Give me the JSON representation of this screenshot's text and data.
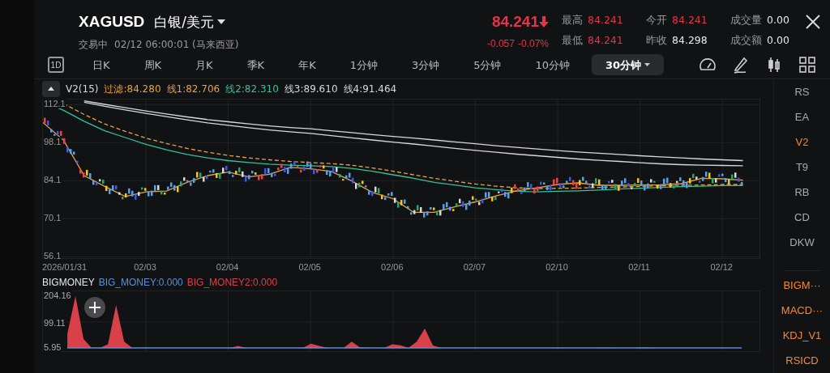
{
  "header": {
    "symbol": "XAGUSD",
    "name": "白银/美元",
    "status": "交易中",
    "time": "02/12 06:00:01 (马来西亚)"
  },
  "quote": {
    "price": "84.241",
    "change": "-0.057",
    "change_pct": "-0.07%"
  },
  "stats": [
    {
      "label": "最高",
      "value": "84.241",
      "color": "#e0364b"
    },
    {
      "label": "今开",
      "value": "84.241",
      "color": "#e0364b"
    },
    {
      "label": "成交量",
      "value": "0.00",
      "color": "#e8e8e8"
    },
    {
      "label": "最低",
      "value": "84.241",
      "color": "#e0364b"
    },
    {
      "label": "昨收",
      "value": "84.298",
      "color": "#e8e8e8"
    },
    {
      "label": "成交额",
      "value": "0.00",
      "color": "#e8e8e8"
    }
  ],
  "day_button": "1D",
  "periods": [
    {
      "label": "日K",
      "selected": false
    },
    {
      "label": "周K",
      "selected": false
    },
    {
      "label": "月K",
      "selected": false
    },
    {
      "label": "季K",
      "selected": false
    },
    {
      "label": "年K",
      "selected": false
    },
    {
      "label": "1分钟",
      "selected": false
    },
    {
      "label": "3分钟",
      "selected": false
    },
    {
      "label": "5分钟",
      "selected": false
    },
    {
      "label": "10分钟",
      "selected": false
    },
    {
      "label": "30分钟",
      "selected": true
    }
  ],
  "main_chart": {
    "title": "V2(15)",
    "chart_data": {
      "type": "line",
      "grid": true,
      "categories": [
        null,
        "2026/01/31",
        null,
        null,
        null,
        "02/03",
        null,
        null,
        null,
        "02/04",
        null,
        null,
        null,
        "02/05",
        null,
        null,
        null,
        "02/06",
        null,
        null,
        null,
        "02/07",
        null,
        null,
        null,
        "02/10",
        null,
        null,
        null,
        "02/11",
        null,
        null,
        null,
        "02/12",
        null
      ],
      "series": [
        {
          "name": "过滤:84.280",
          "color": "#e8a33d",
          "values": [
            105.5,
            99,
            86,
            82,
            78.3,
            80,
            80.3,
            83.5,
            86,
            87.3,
            85.5,
            86.5,
            89,
            88.5,
            87.5,
            84,
            79.8,
            77.5,
            72.5,
            72.5,
            74.5,
            76.3,
            78.5,
            80.4,
            81.5,
            82.7,
            83.3,
            82.4,
            82.4,
            82.5,
            82.6,
            83,
            85,
            84.8,
            84.3
          ]
        },
        {
          "name": "线1:82.706",
          "color": "#e8a33d",
          "line_style": "dashed",
          "values": [
            null,
            112.5,
            108.5,
            105,
            102.3,
            99.8,
            97.8,
            96,
            94.6,
            93.4,
            92.5,
            91.8,
            91.2,
            90.8,
            90.4,
            89.8,
            88.8,
            87.6,
            86.3,
            85,
            83.9,
            82.9,
            82.1,
            81.5,
            81.2,
            81.3,
            81.4,
            81.6,
            81.8,
            82,
            82.2,
            82.4,
            82.5,
            82.7,
            82.7
          ]
        },
        {
          "name": "线2:82.310",
          "color": "#2fc49a",
          "values": [
            113.3,
            110,
            106,
            102.5,
            100,
            97.5,
            95.5,
            93.8,
            92.5,
            91.5,
            90.8,
            90.2,
            89.8,
            89.6,
            89.3,
            88.6,
            87.6,
            86.3,
            85,
            83.5,
            82.5,
            81.5,
            80.8,
            80.2,
            80,
            80.2,
            80.4,
            80.7,
            81,
            81.3,
            81.6,
            81.9,
            82.1,
            82.3,
            82.3
          ]
        },
        {
          "name": "线3:89.610",
          "color": "#d8d8d8",
          "values": [
            null,
            null,
            113,
            111.5,
            110.2,
            108.9,
            107.7,
            106.5,
            105.4,
            104.5,
            103.6,
            102.8,
            102.1,
            101.5,
            100.7,
            99.9,
            99.1,
            98.3,
            97.6,
            96.8,
            96,
            95.3,
            94.6,
            93.9,
            93.3,
            92.7,
            92.1,
            91.6,
            91.2,
            90.7,
            90.3,
            90,
            89.8,
            89.7,
            89.6
          ]
        },
        {
          "name": "线4:91.464",
          "color": "#d8d8d8",
          "values": [
            null,
            null,
            113.5,
            112.2,
            111,
            109.8,
            108.7,
            107.6,
            106.6,
            105.8,
            105,
            104.3,
            103.7,
            103.2,
            102.5,
            101.8,
            101.1,
            100.4,
            99.8,
            99.1,
            98.4,
            97.7,
            97,
            96.4,
            95.8,
            95.2,
            94.7,
            94.2,
            93.8,
            93.3,
            92.9,
            92.5,
            92.1,
            91.8,
            91.5
          ]
        }
      ],
      "ylim": [
        55,
        114
      ],
      "yticks": [
        112.1,
        98.1,
        84.1,
        70.1,
        56.1
      ]
    }
  },
  "sub_chart": {
    "title": "BIGMONEY",
    "chart_data": {
      "type": "area",
      "series": [
        {
          "name": "BIG_MONEY:0.000",
          "color": "#5b8fd6",
          "type": "line",
          "values": [
            null,
            null,
            null,
            6,
            6,
            6,
            6,
            6,
            6,
            6,
            6,
            6,
            6,
            6,
            6,
            6,
            6,
            6,
            6,
            6,
            6,
            6,
            6,
            6,
            6,
            6,
            6,
            6,
            6,
            6,
            6,
            6,
            6,
            6,
            6,
            6,
            6,
            6,
            6,
            6,
            6,
            6,
            6,
            6,
            6,
            6,
            6,
            6,
            6,
            6,
            6,
            6,
            6,
            6,
            6,
            6,
            6,
            6,
            6,
            6,
            6,
            6,
            6,
            6,
            6,
            6,
            6,
            6,
            6,
            6,
            6,
            6,
            6,
            6,
            6,
            6,
            6,
            6,
            6,
            6,
            6,
            6,
            6,
            6,
            6,
            6,
            6
          ]
        },
        {
          "name": "BIG_MONEY2:0.000",
          "color": "#d8404a",
          "values": [
            null,
            null,
            null,
            60,
            204,
            40,
            6,
            6,
            20,
            170,
            30,
            6,
            6,
            6,
            6,
            6,
            6,
            6,
            6,
            6,
            6,
            6,
            6,
            6,
            14,
            6,
            6,
            6,
            6,
            6,
            6,
            6,
            6,
            22,
            14,
            6,
            6,
            6,
            30,
            8,
            6,
            6,
            6,
            20,
            16,
            6,
            30,
            80,
            15,
            6,
            6,
            6,
            6,
            6,
            6,
            6,
            6,
            6,
            6,
            6,
            6,
            6,
            6,
            6,
            6,
            6,
            6,
            6,
            6,
            7,
            6,
            6,
            6,
            6,
            8,
            6,
            6,
            6,
            6,
            6,
            6,
            6,
            6,
            6,
            6,
            6,
            6
          ]
        }
      ],
      "grid": true,
      "ylim": [
        -12.6,
        222.7
      ],
      "yticks": [
        204.16,
        99.11,
        5.95
      ]
    }
  },
  "main_indicators": [
    {
      "label": "RS",
      "selected": false
    },
    {
      "label": "EA",
      "selected": false
    },
    {
      "label": "V2",
      "selected": true
    },
    {
      "label": "T9",
      "selected": false
    },
    {
      "label": "RB",
      "selected": false
    },
    {
      "label": "CD",
      "selected": false
    },
    {
      "label": "DKW",
      "selected": false
    }
  ],
  "sub_indicators": [
    {
      "label": "BIGM···",
      "selected": true
    },
    {
      "label": "MACD···",
      "selected": true
    },
    {
      "label": "KDJ_V1",
      "selected": true
    },
    {
      "label": "RSICD",
      "selected": true
    }
  ]
}
